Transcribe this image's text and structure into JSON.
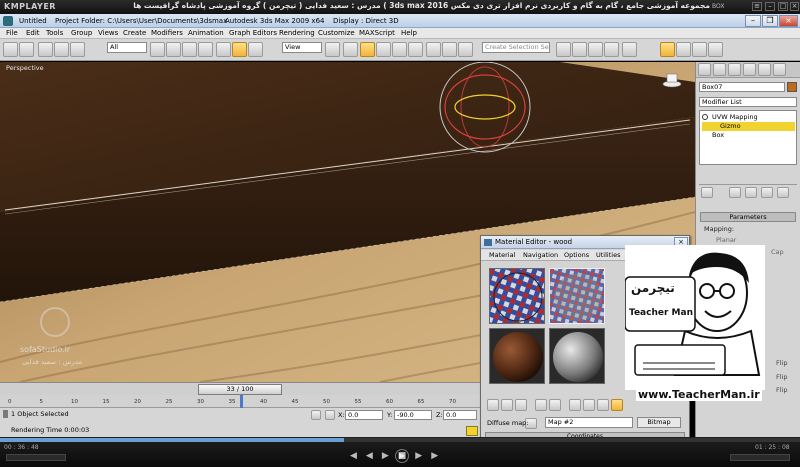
{
  "player": {
    "logo": "KMPLAYER",
    "title": "مجموعه آموزشی جامع ، گام به گام و کاربردی نرم افزار تری دی مکس 3ds max 2016 ) مدرس : سعید فدایی ( تیچرمن ) گروه آموزشی پادشاه گرافیست ها",
    "box_label": "BOX",
    "time_current": "00 : 36 : 48",
    "time_total": "01 : 25 : 08",
    "progress": 0.43
  },
  "max": {
    "tabs": [
      "Untitled",
      "Project Folder: C:\\Users\\User\\Documents\\3dsmax",
      "Autodesk 3ds Max  2009 x64",
      "Display : Direct 3D"
    ],
    "menu": [
      "File",
      "Edit",
      "Tools",
      "Group",
      "Views",
      "Create",
      "Modifiers",
      "Animation",
      "Graph Editors",
      "Rendering",
      "Customize",
      "MAXScript",
      "Help"
    ],
    "toolbar": {
      "filter_value": "All",
      "refcoord_value": "View",
      "selection_set_placeholder": "Create Selection Se"
    },
    "viewport": {
      "label": "Perspective",
      "watermark_brand": "sofaStudio.ir",
      "watermark_name": "مدرس : سعید فدایی"
    },
    "cmd_panel": {
      "object_name": "Box07",
      "modifier_list": "Modifier List",
      "stack": [
        "UVW Mapping",
        "Gizmo",
        "Box"
      ],
      "selected_index": 1,
      "params_title": "Parameters",
      "mapping_label": "Mapping:",
      "options": [
        "Planar",
        "Cap",
        "Flip",
        "Flip",
        "Flip"
      ]
    },
    "timeline": {
      "frame_display": "33 / 100",
      "current_frame": 33,
      "total_frames": 100,
      "ticks": [
        "0",
        "5",
        "10",
        "15",
        "20",
        "25",
        "30",
        "35",
        "40",
        "45",
        "50",
        "55",
        "60",
        "65",
        "70"
      ]
    },
    "status": {
      "selection": "1 Object Selected",
      "render_time": "Rendering Time  0:00:03",
      "x_label": "X:",
      "x_value": "0.0",
      "y_label": "Y:",
      "y_value": "-90.0",
      "z_label": "Z:",
      "z_value": "0.0"
    },
    "material_editor": {
      "title": "Material Editor - wood",
      "menu": [
        "Material",
        "Navigation",
        "Options",
        "Utilities"
      ],
      "diffuse_label": "Diffuse map:",
      "map_value": "Map #2",
      "bitmap_label": "Bitmap",
      "coordinates_label": "Coordinates"
    }
  },
  "overlay": {
    "logo_fa": "تیچرمن",
    "logo_en": "Teacher Man",
    "url": "www.TeacherMan.ir"
  },
  "colors": {
    "wood_dark": "#3b2515",
    "wood_light": "#c9a16a",
    "accent_yellow": "#f2d22e",
    "max_blue": "#bcd0e8"
  }
}
